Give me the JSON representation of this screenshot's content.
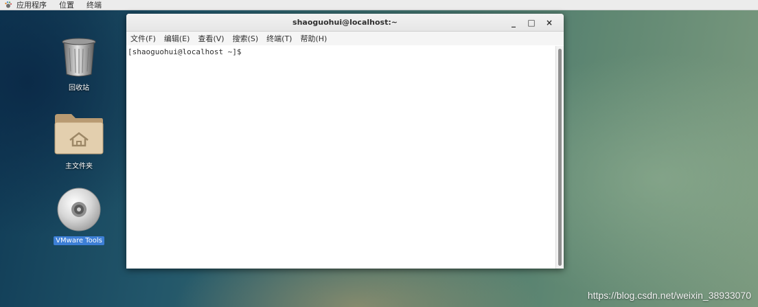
{
  "top_bar": {
    "menus": [
      {
        "label": "应用程序",
        "icon": "gnome-foot-icon"
      },
      {
        "label": "位置"
      },
      {
        "label": "终端"
      }
    ]
  },
  "desktop": {
    "icons": [
      {
        "label": "回收站",
        "icon": "trash-icon"
      },
      {
        "label": "主文件夹",
        "icon": "home-folder-icon"
      },
      {
        "label": "VMware Tools",
        "icon": "cd-disc-icon",
        "selected": true
      }
    ]
  },
  "terminal": {
    "title": "shaoguohui@localhost:~",
    "controls": {
      "minimize": "_",
      "maximize": "□",
      "close": "×"
    },
    "menu": [
      "文件(F)",
      "编辑(E)",
      "查看(V)",
      "搜索(S)",
      "终端(T)",
      "帮助(H)"
    ],
    "prompt": "[shaoguohui@localhost ~]$"
  },
  "watermark": "https://blog.csdn.net/weixin_38933070",
  "colors": {
    "selection": "#3d7fd6",
    "panel": "#ececec"
  }
}
